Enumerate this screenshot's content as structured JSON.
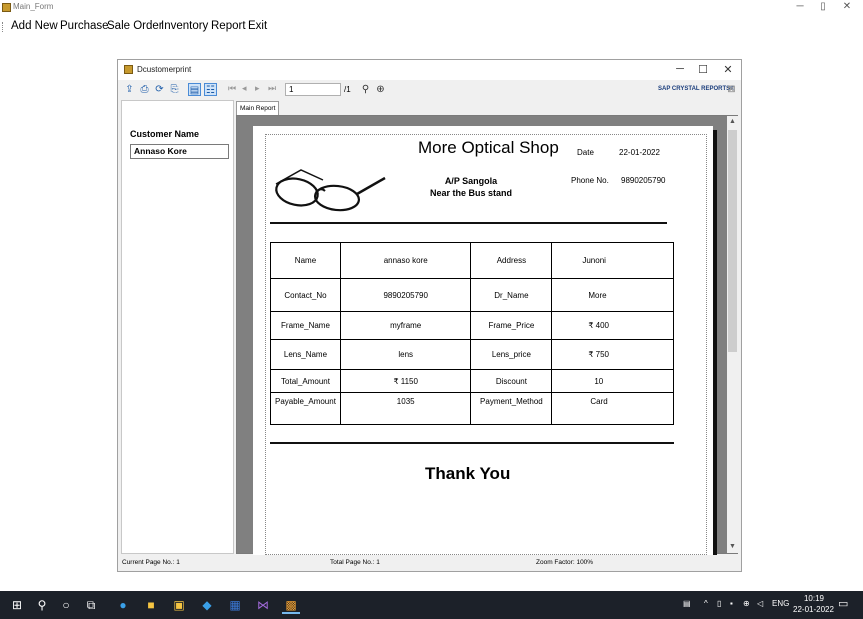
{
  "main_form": {
    "title": "Main_Form",
    "minimize": "─",
    "restore": "▯",
    "close": "✕"
  },
  "menu": {
    "items": [
      "Add New",
      "Purchase",
      "Sale Order",
      "Inventory",
      "Report",
      "Exit"
    ]
  },
  "report_window": {
    "title": "Dcustomerprint",
    "minimize": "─",
    "maximize": "☐",
    "close": "✕",
    "toolbar": {
      "page_value": "1",
      "page_of": "/1",
      "brand": "SAP CRYSTAL REPORTS®"
    },
    "group_tree": {
      "header": "Customer Name",
      "items": [
        "Annaso Kore"
      ]
    },
    "tab_label": "Main Report",
    "status": {
      "current_page": "Current Page No.: 1",
      "total_page": "Total Page No.: 1",
      "zoom": "Zoom Factor: 100%"
    }
  },
  "report": {
    "shop_name": "More Optical Shop",
    "date_label": "Date",
    "date_value": "22-01-2022",
    "phone_label": "Phone No.",
    "phone_value": "9890205790",
    "address_line1": "A/P Sangola",
    "address_line2": "Near the Bus stand",
    "rows": [
      [
        "Name",
        "annaso kore",
        "Address",
        "Junoni"
      ],
      [
        "Contact_No",
        "9890205790",
        "Dr_Name",
        "More"
      ],
      [
        "Frame_Name",
        "myframe",
        "Frame_Price",
        "₹ 400"
      ],
      [
        "Lens_Name",
        "lens",
        "Lens_price",
        "₹ 750"
      ],
      [
        "Total_Amount",
        "₹ 1150",
        "Discount",
        "10"
      ],
      [
        "Payable_Amount",
        "1035",
        "Payment_Method",
        "Card"
      ]
    ],
    "footer": "Thank You"
  },
  "taskbar": {
    "lang": "ENG",
    "time": "10:19",
    "date": "22-01-2022"
  }
}
